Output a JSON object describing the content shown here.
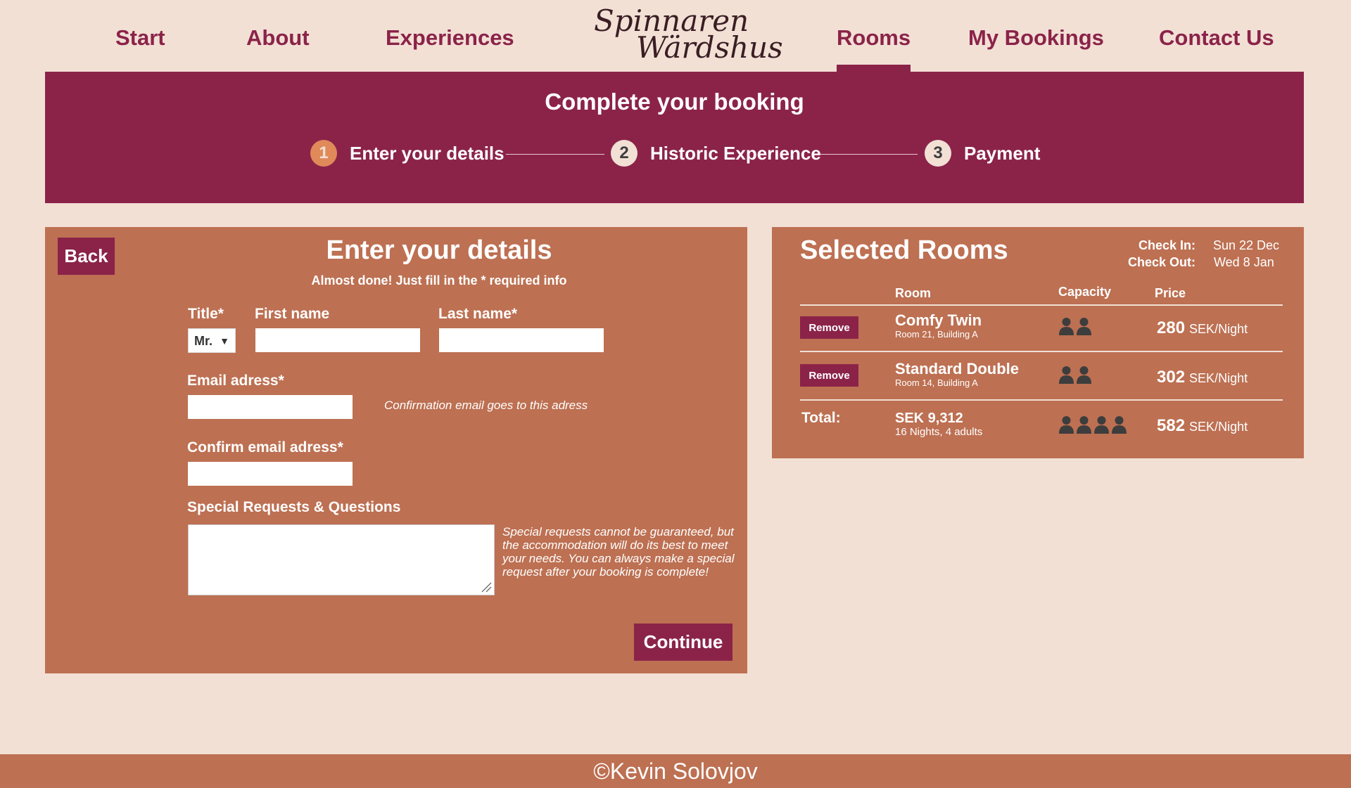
{
  "nav": {
    "items": [
      {
        "label": "Start"
      },
      {
        "label": "About"
      },
      {
        "label": "Experiences"
      },
      {
        "label": "Rooms"
      },
      {
        "label": "My Bookings"
      },
      {
        "label": "Contact Us"
      }
    ],
    "active": "Rooms",
    "logo_line1": "Spinnaren",
    "logo_line2": "Wärdshus"
  },
  "banner": {
    "title": "Complete your booking",
    "steps": [
      {
        "number": "1",
        "label": "Enter your details",
        "current": true
      },
      {
        "number": "2",
        "label": "Historic Experience",
        "current": false
      },
      {
        "number": "3",
        "label": "Payment",
        "current": false
      }
    ]
  },
  "form": {
    "back_label": "Back",
    "title": "Enter your details",
    "subtitle": "Almost done! Just fill in the * required info",
    "title_label": "Title*",
    "title_value": "Mr.",
    "title_arrow": "▼",
    "first_name_label": "First name",
    "first_name_value": "",
    "last_name_label": "Last name*",
    "last_name_value": "",
    "email_label": "Email adress*",
    "email_value": "",
    "email_hint": "Confirmation email goes to this adress",
    "confirm_email_label": "Confirm email adress*",
    "confirm_email_value": "",
    "requests_label": "Special Requests & Questions",
    "requests_value": "",
    "requests_hint": "Special requests cannot be guaranteed, but the accommodation will do its best to meet your needs. You can always make a special request after your booking is complete!",
    "continue_label": "Continue"
  },
  "rooms": {
    "title": "Selected Rooms",
    "check_in_label": "Check In:",
    "check_in_value": "Sun 22 Dec",
    "check_out_label": "Check Out:",
    "check_out_value": "Wed 8 Jan",
    "columns": {
      "room": "Room",
      "capacity": "Capacity",
      "price": "Price"
    },
    "items": [
      {
        "remove_label": "Remove",
        "name": "Comfy Twin",
        "location": "Room 21, Building A",
        "capacity": 2,
        "price": "280",
        "unit": "SEK/Night"
      },
      {
        "remove_label": "Remove",
        "name": "Standard Double",
        "location": "Room 14, Building A",
        "capacity": 2,
        "price": "302",
        "unit": "SEK/Night"
      }
    ],
    "total": {
      "label": "Total:",
      "amount": "SEK 9,312",
      "detail": "16 Nights, 4 adults",
      "capacity": 4,
      "price": "582",
      "unit": "SEK/Night"
    }
  },
  "footer": {
    "text": "©Kevin Solovjov"
  },
  "colors": {
    "primary": "#8b2349",
    "panel": "#bd7052",
    "background": "#f2e0d5",
    "step_current": "#e08a5a"
  }
}
